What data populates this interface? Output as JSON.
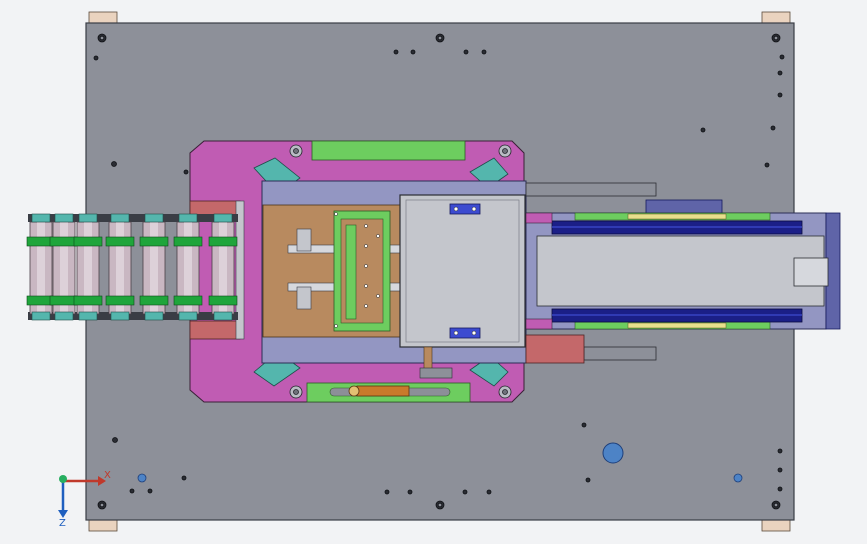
{
  "viewport": {
    "background": "#f2f3f5"
  },
  "colors": {
    "base_plate": "#8d9099",
    "plate_outline": "#3a3d45",
    "frame_magenta": "#c05cb3",
    "green": "#6dcd5f",
    "teal": "#54b6ad",
    "brown_plate": "#b88a5f",
    "lavender": "#9396c2",
    "light_gray": "#c4c6cc",
    "navy": "#1b1f87",
    "blue_bar": "#3c4bd0",
    "salmon": "#c4686a",
    "orange": "#c97a2b",
    "yellow": "#e7e08c",
    "pad": "#ead3bf",
    "steel_blue": "#4d83c6"
  },
  "triad": {
    "x_label": "X",
    "z_label": "Z",
    "x_color": "#c0392b",
    "y_color": "#27ae60",
    "z_color": "#1f5fbf"
  },
  "icons": {
    "triad": "coordinate-triad-icon"
  }
}
